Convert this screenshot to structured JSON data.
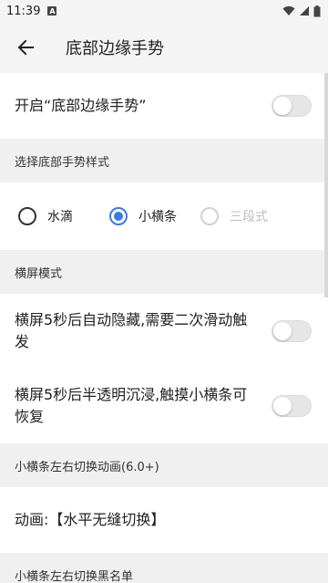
{
  "status_bar": {
    "time": "11:39",
    "notif_icon": "A"
  },
  "toolbar": {
    "title": "底部边缘手势"
  },
  "enable_row": {
    "label": "开启“底部边缘手势”",
    "enabled": false
  },
  "section_style": {
    "label": "选择底部手势样式"
  },
  "style_options": [
    {
      "label": "水滴",
      "checked": false,
      "disabled": false
    },
    {
      "label": "小横条",
      "checked": true,
      "disabled": false
    },
    {
      "label": "三段式",
      "checked": false,
      "disabled": true
    }
  ],
  "section_landscape": {
    "label": "横屏模式"
  },
  "landscape_rows": [
    {
      "label": "横屏5秒后自动隐藏,需要二次滑动触发",
      "enabled": false
    },
    {
      "label": "横屏5秒后半透明沉浸,触摸小横条可恢复",
      "enabled": false
    }
  ],
  "section_animation": {
    "label": "小横条左右切换动画(6.0+)"
  },
  "animation_row": {
    "label": "动画:【水平无缝切换】"
  },
  "section_blacklist": {
    "label": "小横条左右切换黑名单"
  },
  "colors": {
    "accent": "#3b7ddd",
    "background": "#f4f4f4",
    "card": "#ffffff"
  }
}
